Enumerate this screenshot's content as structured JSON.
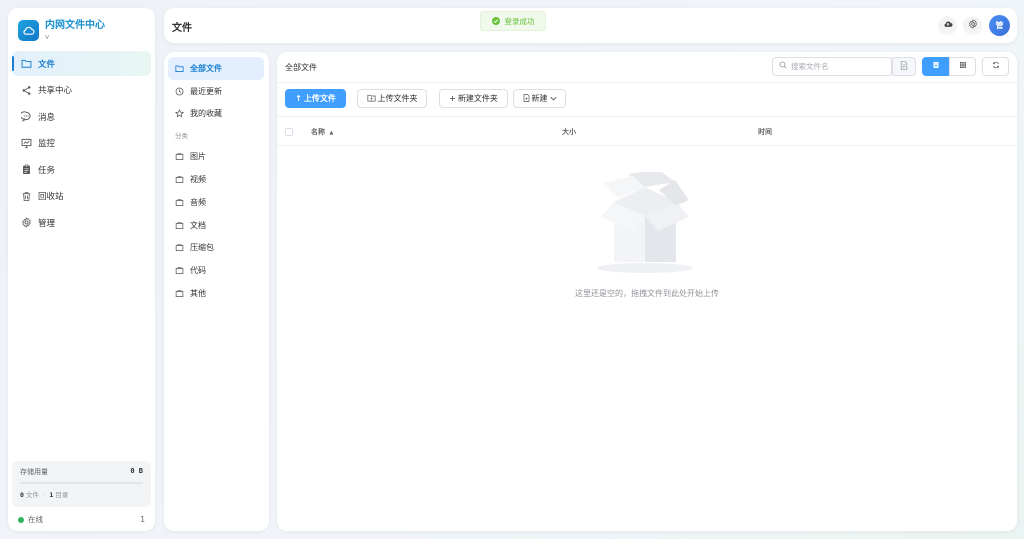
{
  "brand": {
    "title": "内网文件中心",
    "version": "v"
  },
  "nav": [
    {
      "label": "文件",
      "icon": "folder-icon",
      "active": true
    },
    {
      "label": "共享中心",
      "icon": "share-icon"
    },
    {
      "label": "消息",
      "icon": "message-icon"
    },
    {
      "label": "监控",
      "icon": "monitor-icon"
    },
    {
      "label": "任务",
      "icon": "task-icon"
    },
    {
      "label": "回收站",
      "icon": "trash-icon"
    },
    {
      "label": "管理",
      "icon": "gear-icon"
    }
  ],
  "storage": {
    "label": "存储用量",
    "value": "0 B",
    "files_count": "0",
    "files_label": "文件",
    "dirs_count": "1",
    "dirs_label": "目录",
    "separator": "·"
  },
  "online": {
    "label": "在线",
    "count": "1"
  },
  "header": {
    "title": "文件",
    "toast": "登录成功",
    "avatar_text": "管"
  },
  "categories": {
    "top": [
      {
        "label": "全部文件",
        "icon": "folder-icon",
        "active": true
      },
      {
        "label": "最近更新",
        "icon": "clock-icon"
      },
      {
        "label": "我的收藏",
        "icon": "star-icon"
      }
    ],
    "section_label": "分类",
    "items": [
      {
        "label": "图片",
        "icon": "folder-icon"
      },
      {
        "label": "视频",
        "icon": "folder-icon"
      },
      {
        "label": "音频",
        "icon": "folder-icon"
      },
      {
        "label": "文档",
        "icon": "folder-icon"
      },
      {
        "label": "压缩包",
        "icon": "folder-icon"
      },
      {
        "label": "代码",
        "icon": "folder-icon"
      },
      {
        "label": "其他",
        "icon": "folder-icon"
      }
    ]
  },
  "main": {
    "breadcrumb": "全部文件",
    "search_placeholder": "搜索文件名",
    "buttons": {
      "upload_file": "上传文件",
      "upload_folder": "上传文件夹",
      "new_folder": "新建文件夹",
      "new": "新建"
    },
    "columns": {
      "name": "名称",
      "size": "大小",
      "time": "时间"
    },
    "empty_text": "这里还是空的，拖拽文件到此处开始上传"
  },
  "colors": {
    "primary": "#409eff",
    "brand": "#1a8fd0",
    "success": "#67c23a",
    "online": "#2db55d"
  }
}
